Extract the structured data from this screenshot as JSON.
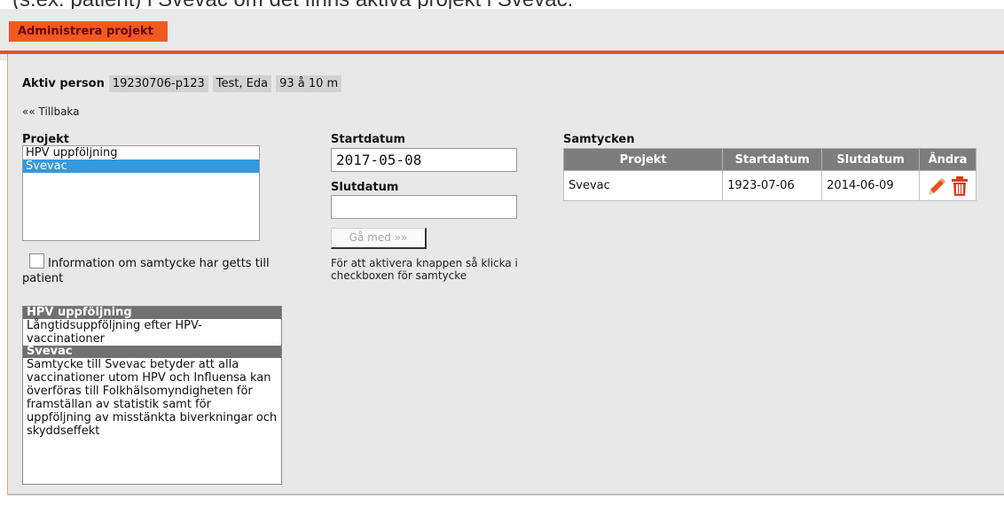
{
  "caption": "(s.ex. patient) i Svevac om det finns aktiva projekt i Svevac.",
  "header": {
    "tab_label": "Administrera projekt"
  },
  "person": {
    "label": "Aktiv person",
    "id": "19230706-p123",
    "name": "Test, Eda",
    "age": "93 å 10 m"
  },
  "back_link": "«« Tillbaka",
  "projects": {
    "label": "Projekt",
    "items": [
      "HPV uppföljning",
      "Svevac"
    ],
    "selected": "Svevac"
  },
  "consent_checkbox": {
    "label": "Information om samtycke har getts till patient"
  },
  "info": [
    {
      "title": "HPV uppföljning",
      "text": "Långtidsuppföljning efter HPV-vaccinationer"
    },
    {
      "title": "Svevac",
      "text": "Samtycke till Svevac betyder att alla vaccinationer utom HPV och Influensa kan överföras till Folkhälsomyndigheten för framställan av statistik samt för uppföljning av misstänkta biverkningar och skyddseffekt"
    }
  ],
  "form": {
    "start_label": "Startdatum",
    "start_value": "2017-05-08",
    "end_label": "Slutdatum",
    "end_value": "",
    "join_button": "Gå med »»",
    "help_text": "För att aktivera knappen så klicka i checkboxen för samtycke"
  },
  "consents": {
    "label": "Samtycken",
    "columns": [
      "Projekt",
      "Startdatum",
      "Slutdatum",
      "Ändra"
    ],
    "rows": [
      {
        "project": "Svevac",
        "start": "1923-07-06",
        "end": "2014-06-09"
      }
    ]
  },
  "icons": {
    "edit": "pencil-icon",
    "delete": "trash-icon"
  },
  "colors": {
    "accent": "#f05a1f",
    "selection": "#3399e0",
    "table_header": "#7d7d7d",
    "edit_icon": "#e8501f",
    "delete_icon": "#e03a1a"
  }
}
